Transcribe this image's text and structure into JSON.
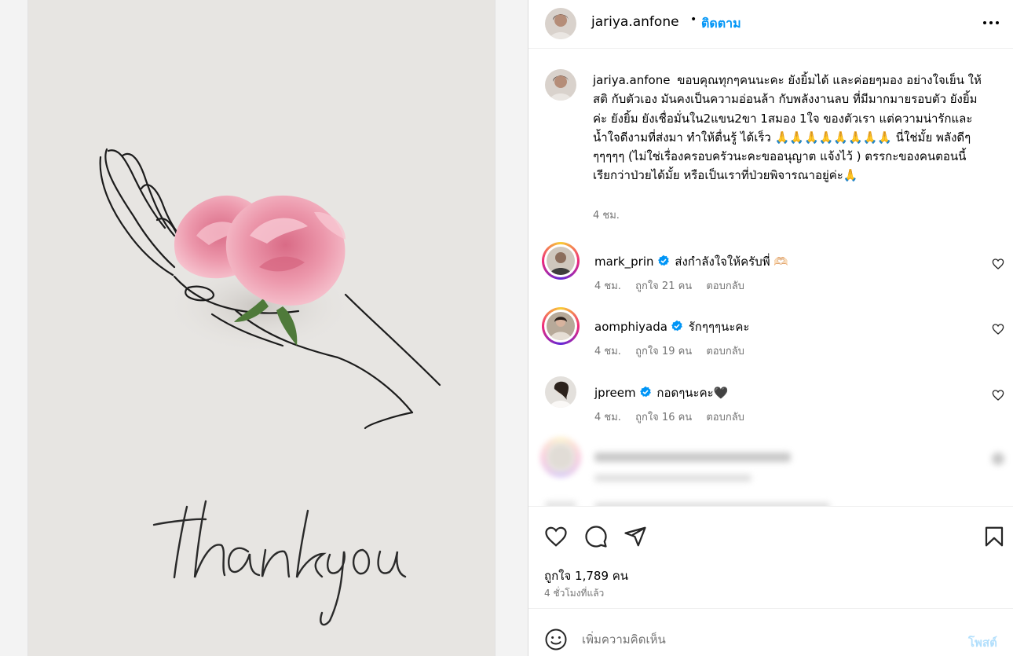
{
  "media": {
    "card_text": "thank you",
    "colors": {
      "card_bg": "#e7e5e2",
      "rose": "#e98fa5",
      "leaf": "#4f7a3a"
    }
  },
  "header": {
    "username": "jariya.anfone",
    "separator": "•",
    "follow_label": "ติดตาม",
    "more_icon": "more-horizontal-icon"
  },
  "caption": {
    "username": "jariya.anfone",
    "text": "ขอบคุณทุกๆคนนะคะ ยังยิ้มได้ และค่อยๆมอง อย่างใจเย็น ให้สติ กับตัวเอง มันคงเป็นความอ่อนล้า กับพลังงานลบ ที่มีมากมายรอบตัว ยังยิ้มค่ะ ยังยิ้ม ยังเชื่อมั่นใน2แขน2ขา 1สมอง 1ใจ ของตัวเรา แต่ความน่ารักและน้ำใจดีงามที่ส่งมา ทำให้ตื่นรู้ ได้เร็ว 🙏🙏🙏🙏🙏🙏🙏🙏 นี่ใช่มั้ย พลังดีๆๆๆๆๆๆ (ไม่ใช่เรื่องครอบครัวนะคะขออนุญาต แจ้งไว้ ) ตรรกะของคนตอนนี้เรียกว่าป่วยได้มั้ย หรือเป็นเราที่ป่วยพิจารณาอยู่ค่ะ🙏",
    "time": "4 ชม."
  },
  "comments": [
    {
      "username": "mark_prin",
      "verified": true,
      "text": "ส่งกำลังใจให้ครับพี่ 🫶🏻",
      "time": "4 ชม.",
      "likes": "ถูกใจ 21 คน",
      "reply": "ตอบกลับ",
      "story_ring": true
    },
    {
      "username": "aomphiyada",
      "verified": true,
      "text": "รักๆๆๆนะคะ",
      "time": "4 ชม.",
      "likes": "ถูกใจ 19 คน",
      "reply": "ตอบกลับ",
      "story_ring": true
    },
    {
      "username": "jpreem",
      "verified": true,
      "text": "กอดๆนะคะ🖤",
      "time": "4 ชม.",
      "likes": "ถูกใจ 16 คน",
      "reply": "ตอบกลับ",
      "story_ring": false
    }
  ],
  "actions": {
    "like_icon": "heart-icon",
    "comment_icon": "comment-icon",
    "share_icon": "share-icon",
    "save_icon": "bookmark-icon",
    "likes_text": "ถูกใจ 1,789 คน",
    "time_ago": "4 ชั่วโมงที่แล้ว"
  },
  "add_comment": {
    "emoji_icon": "emoji-icon",
    "placeholder": "เพิ่มความคิดเห็น",
    "post_label": "โพสต์"
  },
  "colors": {
    "link_blue": "#0095f6",
    "muted": "#737373",
    "verified": "#0095f6",
    "post_disabled": "#b2dffc"
  }
}
